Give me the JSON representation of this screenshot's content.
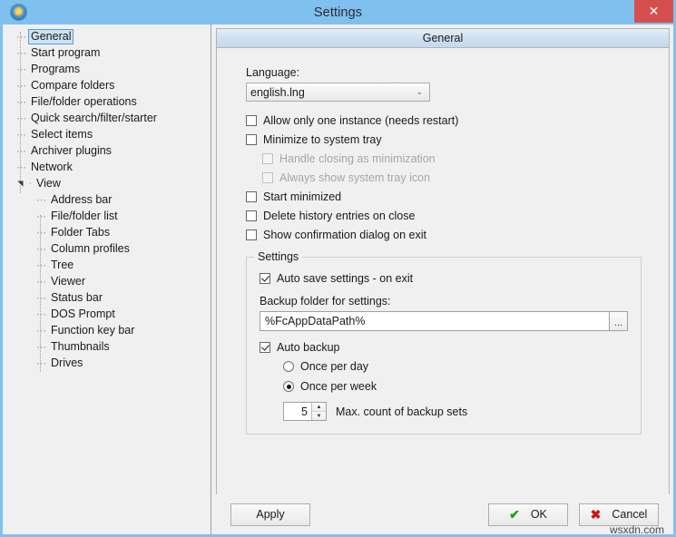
{
  "window": {
    "title": "Settings",
    "app_icon": "globe-icon",
    "close_label": "✕"
  },
  "sidebar": {
    "items": [
      {
        "label": "General",
        "level": 0,
        "selected": true,
        "expander": ""
      },
      {
        "label": "Start program",
        "level": 0,
        "selected": false,
        "expander": ""
      },
      {
        "label": "Programs",
        "level": 0,
        "selected": false,
        "expander": ""
      },
      {
        "label": "Compare folders",
        "level": 0,
        "selected": false,
        "expander": ""
      },
      {
        "label": "File/folder operations",
        "level": 0,
        "selected": false,
        "expander": ""
      },
      {
        "label": "Quick search/filter/starter",
        "level": 0,
        "selected": false,
        "expander": ""
      },
      {
        "label": "Select items",
        "level": 0,
        "selected": false,
        "expander": ""
      },
      {
        "label": "Archiver plugins",
        "level": 0,
        "selected": false,
        "expander": ""
      },
      {
        "label": "Network",
        "level": 0,
        "selected": false,
        "expander": ""
      },
      {
        "label": "View",
        "level": 0,
        "selected": false,
        "expander": "expanded"
      },
      {
        "label": "Address bar",
        "level": 1,
        "selected": false,
        "expander": ""
      },
      {
        "label": "File/folder list",
        "level": 1,
        "selected": false,
        "expander": ""
      },
      {
        "label": "Folder Tabs",
        "level": 1,
        "selected": false,
        "expander": ""
      },
      {
        "label": "Column profiles",
        "level": 1,
        "selected": false,
        "expander": ""
      },
      {
        "label": "Tree",
        "level": 1,
        "selected": false,
        "expander": ""
      },
      {
        "label": "Viewer",
        "level": 1,
        "selected": false,
        "expander": ""
      },
      {
        "label": "Status bar",
        "level": 1,
        "selected": false,
        "expander": ""
      },
      {
        "label": "DOS Prompt",
        "level": 1,
        "selected": false,
        "expander": ""
      },
      {
        "label": "Function key bar",
        "level": 1,
        "selected": false,
        "expander": ""
      },
      {
        "label": "Thumbnails",
        "level": 1,
        "selected": false,
        "expander": ""
      },
      {
        "label": "Drives",
        "level": 1,
        "selected": false,
        "expander": ""
      }
    ]
  },
  "panel": {
    "header": "General",
    "language": {
      "label": "Language:",
      "value": "english.lng",
      "arrow": "⌄"
    },
    "checkboxes": [
      {
        "label": "Allow only one instance (needs restart)",
        "checked": false,
        "disabled": false,
        "indent": false
      },
      {
        "label": "Minimize to system tray",
        "checked": false,
        "disabled": false,
        "indent": false
      },
      {
        "label": "Handle closing as minimization",
        "checked": false,
        "disabled": true,
        "indent": true
      },
      {
        "label": "Always show system tray icon",
        "checked": false,
        "disabled": true,
        "indent": true
      },
      {
        "label": "Start minimized",
        "checked": false,
        "disabled": false,
        "indent": false
      },
      {
        "label": "Delete history entries on close",
        "checked": false,
        "disabled": false,
        "indent": false
      },
      {
        "label": "Show confirmation dialog on exit",
        "checked": false,
        "disabled": false,
        "indent": false
      }
    ],
    "settings_group": {
      "title": "Settings",
      "auto_save": {
        "label": "Auto save settings - on exit",
        "checked": true
      },
      "backup_folder": {
        "label": "Backup folder for settings:",
        "value": "%FcAppDataPath%",
        "browse_label": "..."
      },
      "auto_backup": {
        "label": "Auto backup",
        "checked": true
      },
      "frequency_options": [
        {
          "label": "Once per day",
          "selected": false
        },
        {
          "label": "Once per week",
          "selected": true
        }
      ],
      "max_backup_sets": {
        "value": "5",
        "label": "Max. count of backup sets",
        "up_arrow": "▲",
        "down_arrow": "▼"
      }
    }
  },
  "footer": {
    "apply_label": "Apply",
    "ok_label": "OK",
    "ok_icon": "✔",
    "cancel_label": "Cancel",
    "cancel_icon": "✖"
  },
  "watermark": "wsxdn.com"
}
